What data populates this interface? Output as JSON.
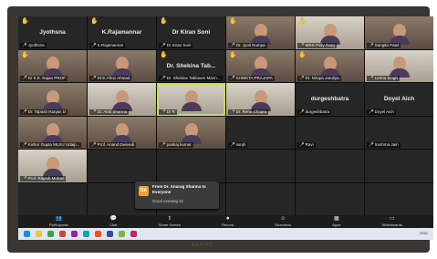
{
  "window": {
    "app": "Zoom Meeting",
    "view": "Gallery"
  },
  "tiles": [
    {
      "big": "Jyothsna",
      "name": "Jyothsna",
      "style": "dark",
      "hand": true
    },
    {
      "big": "K.Rajamannar",
      "name": "K.Rajamannar",
      "style": "dark",
      "hand": true
    },
    {
      "big": "Dr Kiran Soni",
      "name": "Dr Kiran Soni",
      "style": "dark",
      "hand": true
    },
    {
      "big": "",
      "name": "Dr. Jyoti Rumpa",
      "style": "cam",
      "hand": true
    },
    {
      "big": "",
      "name": "MRS Polly Garg",
      "style": "light",
      "hand": true
    },
    {
      "big": "",
      "name": "Sangita Patel",
      "style": "cam",
      "hand": false
    },
    {
      "big": "",
      "name": "Dr K.K. Rajan PROF",
      "style": "cam",
      "hand": true
    },
    {
      "big": "",
      "name": "Dr.E.Afroz Ahmad",
      "style": "cam",
      "hand": false
    },
    {
      "big": "Dr. Shekina Tab...",
      "name": "Dr. Shekina Tabbsum Mann...",
      "style": "dark",
      "hand": true
    },
    {
      "big": "",
      "name": "SHWETA PRAJAPA",
      "style": "cam",
      "hand": true
    },
    {
      "big": "",
      "name": "Dr. Nirupa Jaroliya",
      "style": "cam",
      "hand": true
    },
    {
      "big": "",
      "name": "Leena Singh",
      "style": "light",
      "hand": false
    },
    {
      "big": "",
      "name": "Dr. Tapash Ranjan D",
      "style": "cam",
      "hand": false
    },
    {
      "big": "",
      "name": "Dr. Alok Sharma",
      "style": "light",
      "hand": false
    },
    {
      "big": "",
      "name": "Dr R",
      "style": "light",
      "hand": false,
      "active": true
    },
    {
      "big": "",
      "name": "Dr. Renu Chopra",
      "style": "light",
      "hand": false
    },
    {
      "big": "durgeshbatra",
      "name": "durgeshbatra",
      "style": "dark",
      "hand": false
    },
    {
      "big": "Doyel Aich",
      "name": "Doyel Aich",
      "style": "dark",
      "hand": false
    },
    {
      "big": "",
      "name": "Kishor Gupta MLSU Udaip...",
      "style": "cam",
      "hand": false
    },
    {
      "big": "",
      "name": "Prof. Anand Dwivedi",
      "style": "cam",
      "hand": false
    },
    {
      "big": "",
      "name": "pankaj kumar",
      "style": "cam",
      "hand": false
    },
    {
      "big": "",
      "name": "sunjh",
      "style": "dark",
      "hand": false
    },
    {
      "big": "",
      "name": "Ravi",
      "style": "dark",
      "hand": false
    },
    {
      "big": "",
      "name": "Sushma Jain",
      "style": "dark",
      "hand": false
    },
    {
      "big": "",
      "name": "Prof. Rajesh Mohan",
      "style": "light",
      "hand": false
    }
  ],
  "chat_toast": {
    "initials": "DA",
    "from": "From Dr. Anurag Sharma to Everyone",
    "message": "Good evening sir"
  },
  "toolbar": [
    {
      "label": "Participants",
      "icon": "people-icon",
      "glyph": "👥",
      "tone": "normal"
    },
    {
      "label": "Chat",
      "icon": "chat-icon",
      "glyph": "💬",
      "tone": "normal"
    },
    {
      "label": "Share Screen",
      "icon": "share-screen-icon",
      "glyph": "⬆",
      "tone": "green"
    },
    {
      "label": "Record",
      "icon": "record-icon",
      "glyph": "⏺",
      "tone": "normal"
    },
    {
      "label": "Reactions",
      "icon": "reactions-icon",
      "glyph": "☺",
      "tone": "normal"
    },
    {
      "label": "Apps",
      "icon": "apps-icon",
      "glyph": "▦",
      "tone": "normal"
    },
    {
      "label": "Whiteboards",
      "icon": "whiteboard-icon",
      "glyph": "▭",
      "tone": "normal"
    }
  ],
  "taskbar_colors": [
    "#1e88e5",
    "#fbc02d",
    "#43a047",
    "#e53935",
    "#8e24aa",
    "#00acc1",
    "#f4511e",
    "#3949ab",
    "#7cb342",
    "#d81b60"
  ],
  "tray_text": "ENG",
  "laptop_brand": "ASPIRE"
}
